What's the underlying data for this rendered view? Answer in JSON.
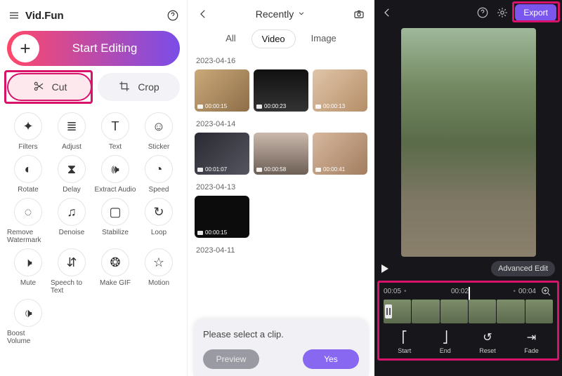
{
  "p1": {
    "brand": "Vid.Fun",
    "start_label": "Start Editing",
    "cut_label": "Cut",
    "crop_label": "Crop",
    "tools": [
      {
        "label": "Filters",
        "icon": "✦"
      },
      {
        "label": "Adjust",
        "icon": "≣"
      },
      {
        "label": "Text",
        "icon": "T"
      },
      {
        "label": "Sticker",
        "icon": "☺"
      },
      {
        "label": "Rotate",
        "icon": "◐"
      },
      {
        "label": "Delay",
        "icon": "⧗"
      },
      {
        "label": "Extract Audio",
        "icon": "🕪"
      },
      {
        "label": "Speed",
        "icon": "◔"
      },
      {
        "label": "Remove Watermark",
        "icon": "◌"
      },
      {
        "label": "Denoise",
        "icon": "♫"
      },
      {
        "label": "Stabilize",
        "icon": "▢"
      },
      {
        "label": "Loop",
        "icon": "↻"
      },
      {
        "label": "Mute",
        "icon": "🕨"
      },
      {
        "label": "Speech to Text",
        "icon": "⇵"
      },
      {
        "label": "Make GIF",
        "icon": "❂"
      },
      {
        "label": "Motion",
        "icon": "☆"
      },
      {
        "label": "Boost Volume",
        "icon": "🕩"
      }
    ]
  },
  "p2": {
    "sort": "Recently",
    "tabs": {
      "all": "All",
      "video": "Video",
      "image": "Image"
    },
    "groups": [
      {
        "date": "2023-04-16",
        "items": [
          {
            "dur": "00:00:15",
            "cls": "a"
          },
          {
            "dur": "00:00:23",
            "cls": "b"
          },
          {
            "dur": "00:00:13",
            "cls": "c"
          }
        ]
      },
      {
        "date": "2023-04-14",
        "items": [
          {
            "dur": "00:01:07",
            "cls": "d"
          },
          {
            "dur": "00:00:58",
            "cls": "e"
          },
          {
            "dur": "00:00:41",
            "cls": "f"
          }
        ]
      },
      {
        "date": "2023-04-13",
        "items": [
          {
            "dur": "00:00:15",
            "cls": "g"
          }
        ]
      },
      {
        "date": "2023-04-11",
        "items": []
      }
    ],
    "modal": {
      "msg": "Please select a clip.",
      "preview": "Preview",
      "yes": "Yes"
    }
  },
  "p3": {
    "export": "Export",
    "advanced": "Advanced Edit",
    "times": {
      "l": "00:05",
      "c": "00:02",
      "r": "00:04"
    },
    "tools": [
      {
        "label": "Start",
        "icon": "⎡"
      },
      {
        "label": "End",
        "icon": "⎦"
      },
      {
        "label": "Reset",
        "icon": "↺"
      },
      {
        "label": "Fade",
        "icon": "⇥"
      }
    ]
  }
}
